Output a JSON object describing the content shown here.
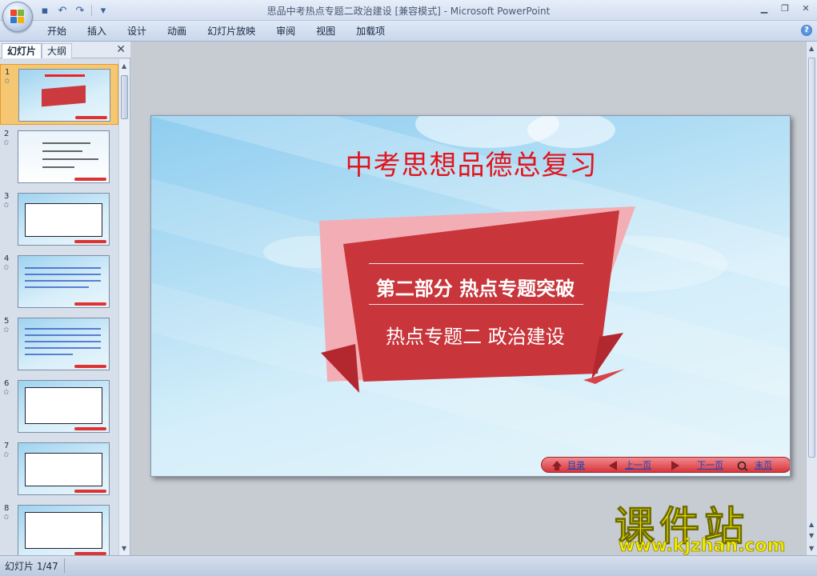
{
  "window": {
    "title": "思品中考热点专题二政治建设 [兼容模式] - Microsoft PowerPoint",
    "controls": [
      "minimize-icon",
      "restore-icon",
      "close-icon"
    ]
  },
  "quick_access": [
    {
      "name": "save-icon",
      "glyph": "▪"
    },
    {
      "name": "undo-icon",
      "glyph": "↶"
    },
    {
      "name": "redo-icon",
      "glyph": "↷"
    },
    {
      "name": "customize-icon",
      "glyph": "▾"
    }
  ],
  "ribbon": {
    "tabs": [
      "开始",
      "插入",
      "设计",
      "动画",
      "幻灯片放映",
      "审阅",
      "视图",
      "加载项"
    ]
  },
  "left_panel": {
    "tabs": {
      "slides": "幻灯片",
      "outline": "大纲"
    },
    "close_glyph": "✕",
    "thumbnails": [
      {
        "num": "1",
        "selected": true
      },
      {
        "num": "2",
        "selected": false
      },
      {
        "num": "3",
        "selected": false
      },
      {
        "num": "4",
        "selected": false
      },
      {
        "num": "5",
        "selected": false
      },
      {
        "num": "6",
        "selected": false
      },
      {
        "num": "7",
        "selected": false
      },
      {
        "num": "8",
        "selected": false
      }
    ],
    "star_glyph": "✩"
  },
  "slide": {
    "title": "中考思想品德总复习",
    "part": "第二部分 热点专题突破",
    "topic": "热点专题二 政治建设",
    "nav": {
      "toc": "目录",
      "prev": "上一页",
      "next": "下一页",
      "end": "末页"
    }
  },
  "status": {
    "slide_indicator": "幻灯片 1/47"
  },
  "watermark": {
    "text": "课件站",
    "url": "www.kjzhan.com"
  },
  "colors": {
    "title_red": "#e2141d",
    "banner_red": "#c8353b",
    "banner_pink": "#f2aeb4"
  }
}
